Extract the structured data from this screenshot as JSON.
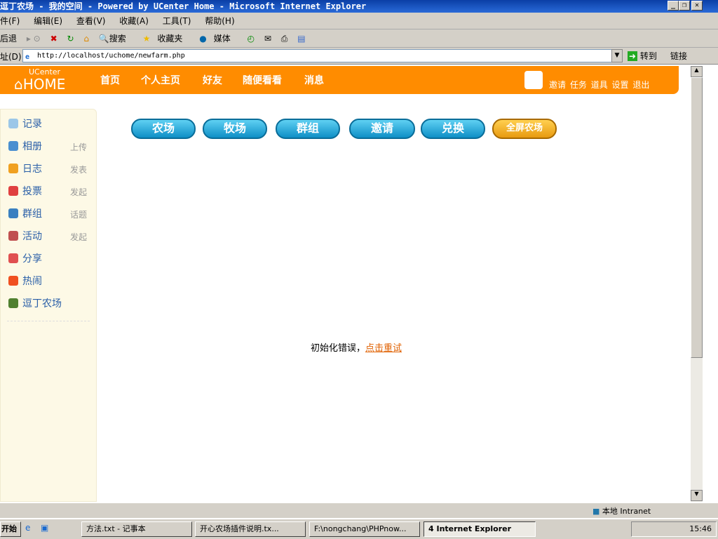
{
  "window": {
    "title": "逗丁农场 - 我的空间 - Powered by UCenter Home - Microsoft Internet Explorer"
  },
  "menu": [
    "件(F)",
    "编辑(E)",
    "查看(V)",
    "收藏(A)",
    "工具(T)",
    "帮助(H)"
  ],
  "toolbar": {
    "back": "后退",
    "search": "搜索",
    "favorites": "收藏夹",
    "media": "媒体"
  },
  "address": {
    "label": "址(D)",
    "url": "http://localhost/uchome/newfarm.php",
    "go": "转到",
    "links": "链接"
  },
  "header": {
    "logo_top": "UCenter",
    "logo_main": "HOME",
    "nav": [
      "首页",
      "个人主页",
      "好友",
      "随便看看",
      "消息"
    ],
    "user_links": [
      "邀请",
      "任务",
      "道具",
      "设置",
      "退出"
    ]
  },
  "sidebar": [
    {
      "label": "记录",
      "action": "",
      "color": "#9cc7e8"
    },
    {
      "label": "相册",
      "action": "上传",
      "color": "#4a8fd0"
    },
    {
      "label": "日志",
      "action": "发表",
      "color": "#f0a020"
    },
    {
      "label": "投票",
      "action": "发起",
      "color": "#e04040"
    },
    {
      "label": "群组",
      "action": "话题",
      "color": "#3a80c0"
    },
    {
      "label": "活动",
      "action": "发起",
      "color": "#c05050"
    },
    {
      "label": "分享",
      "action": "",
      "color": "#e05050"
    },
    {
      "label": "热闹",
      "action": "",
      "color": "#f05020"
    },
    {
      "label": "逗丁农场",
      "action": "",
      "color": "#508030"
    }
  ],
  "game_buttons": [
    "农场",
    "牧场",
    "群组",
    "邀请",
    "兑换",
    "全屏农场"
  ],
  "message": {
    "text": "初始化错误，",
    "link": "点击重试"
  },
  "status": {
    "zone": "本地 Intranet"
  },
  "taskbar": {
    "start": "开始",
    "items": [
      "方法.txt - 记事本",
      "开心农场插件说明.tx...",
      "F:\\nongchang\\PHPnow...",
      "4 Internet Explorer"
    ],
    "clock": "15:46"
  }
}
